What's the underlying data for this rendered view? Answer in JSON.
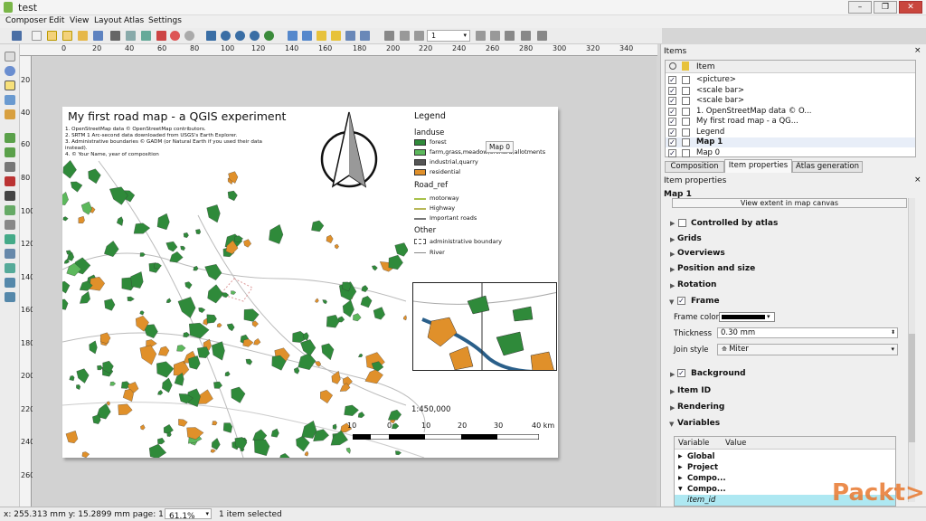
{
  "window": {
    "title": "test"
  },
  "menu": [
    "Composer",
    "Edit",
    "View",
    "Layout",
    "Atlas",
    "Settings"
  ],
  "toolbar": {
    "page_value": "1"
  },
  "ruler": {
    "h_ticks": [
      "0",
      "20",
      "40",
      "60",
      "80",
      "100",
      "120",
      "140",
      "160",
      "180",
      "200",
      "220",
      "240",
      "260",
      "280",
      "300",
      "320",
      "340"
    ],
    "v_ticks": [
      "20",
      "40",
      "60",
      "80",
      "100",
      "120",
      "140",
      "160",
      "180",
      "200",
      "220",
      "240",
      "260"
    ]
  },
  "composition": {
    "title": "My first road map - a QGIS experiment",
    "credits": [
      "1. OpenStreetMap data © OpenStreetMap contributors.",
      "2. SRTM 1 Arc-second data downloaded from USGS's Earth Explorer.",
      "3. Administrative boundaries © GADM (or Natural Earth if you used their data",
      "instead).",
      "4. © Your Name, year of composition"
    ],
    "tooltip": "Map 0",
    "legend": {
      "title": "Legend",
      "landuse_heading": "landuse",
      "landuse": [
        {
          "label": "forest",
          "color": "#2f8a3a"
        },
        {
          "label": "farm,grass,meadow,orchard,allotments",
          "color": "#5cb85c"
        },
        {
          "label": "industrial,quarry",
          "color": "#555555"
        },
        {
          "label": "residential",
          "color": "#e0902a"
        }
      ],
      "road_heading": "Road_ref",
      "roads": [
        {
          "label": "motorway",
          "color": "#a8c14a"
        },
        {
          "label": "Highway",
          "color": "#b8b85a"
        },
        {
          "label": "Important roads",
          "color": "#777777"
        }
      ],
      "other_heading": "Other",
      "other": [
        "administrative boundary",
        "River"
      ]
    },
    "scale_text": "1:450,000",
    "scalebar_labels": [
      "10",
      "0",
      "10",
      "20",
      "30",
      "40 km"
    ]
  },
  "panel": {
    "items_title": "Items",
    "items_col": "Item",
    "items": [
      {
        "label": "<picture>",
        "bold": false
      },
      {
        "label": "<scale bar>",
        "bold": false
      },
      {
        "label": "<scale bar>",
        "bold": false
      },
      {
        "label": "1. OpenStreetMap data © O...",
        "bold": false
      },
      {
        "label": "My first road map - a QG...",
        "bold": false
      },
      {
        "label": "Legend",
        "bold": false
      },
      {
        "label": "Map 1",
        "bold": true
      },
      {
        "label": "Map 0",
        "bold": false
      }
    ],
    "tabs": [
      "Composition",
      "Item properties",
      "Atlas generation"
    ],
    "props_title": "Item properties",
    "item_name": "Map 1",
    "view_extent_btn": "View extent in map canvas",
    "controlled_by_atlas": "Controlled by atlas",
    "sections": [
      "Grids",
      "Overviews",
      "Position and size",
      "Rotation"
    ],
    "frame": "Frame",
    "frame_color_label": "Frame color",
    "thickness_label": "Thickness",
    "thickness_value": "0.30 mm",
    "join_label": "Join style",
    "join_value": "Miter",
    "background": "Background",
    "sections2": [
      "Item ID",
      "Rendering",
      "Variables"
    ],
    "var_cols": [
      "Variable",
      "Value"
    ],
    "var_rows": [
      "Global",
      "Project",
      "Compo...",
      "Compo..."
    ],
    "var_item": "item_id"
  },
  "status": {
    "coords": "x: 255.313 mm y: 15.2899 mm page: 1",
    "zoom": "61.1%",
    "selected": "1 item selected"
  },
  "watermark": "Packt>"
}
